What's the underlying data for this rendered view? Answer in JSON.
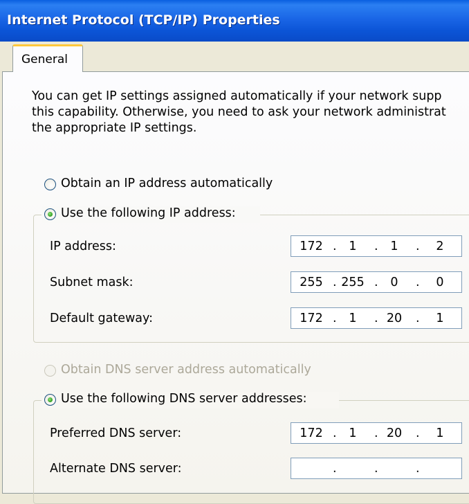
{
  "window": {
    "title": "Internet Protocol (TCP/IP) Properties"
  },
  "tabs": [
    {
      "label": "General",
      "active": true
    }
  ],
  "intro": {
    "lines": [
      "You can get IP settings assigned automatically if your network supp",
      "this capability. Otherwise, you need to ask your network administrat",
      "the appropriate IP settings."
    ]
  },
  "ip_settings": {
    "auto_label": "Obtain an IP address automatically",
    "auto_selected": false,
    "manual_label": "Use the following IP address:",
    "manual_selected": true,
    "fields": [
      {
        "label": "IP address:",
        "octets": [
          "172",
          "1",
          "1",
          "2"
        ]
      },
      {
        "label": "Subnet mask:",
        "octets": [
          "255",
          "255",
          "0",
          "0"
        ]
      },
      {
        "label": "Default gateway:",
        "octets": [
          "172",
          "1",
          "20",
          "1"
        ]
      }
    ]
  },
  "dns_settings": {
    "auto_label": "Obtain DNS server address automatically",
    "auto_enabled": false,
    "manual_label": "Use the following DNS server addresses:",
    "manual_selected": true,
    "fields": [
      {
        "label": "Preferred DNS server:",
        "octets": [
          "172",
          "1",
          "20",
          "1"
        ]
      },
      {
        "label": "Alternate DNS server:",
        "octets": [
          "",
          "",
          "",
          ""
        ]
      }
    ]
  },
  "colors": {
    "title_bar": "#0a5fe0",
    "tab_highlight": "#ffc83c",
    "radio_dot": "#2f9c1e",
    "disabled_text": "#aca899"
  }
}
